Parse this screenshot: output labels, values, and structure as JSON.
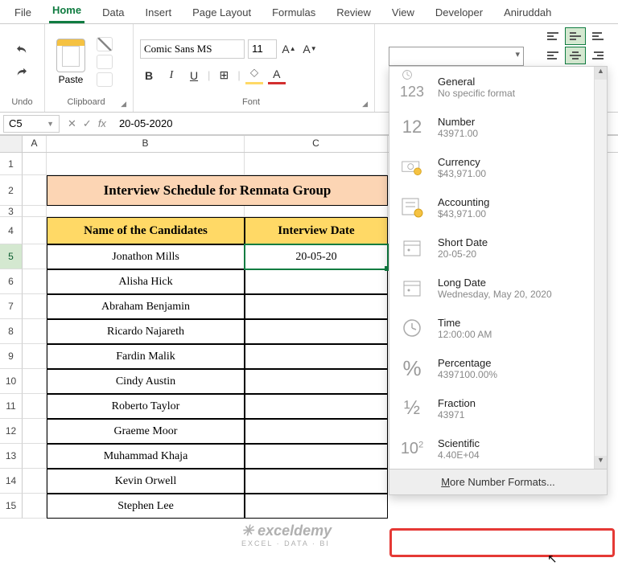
{
  "tabs": [
    "File",
    "Home",
    "Data",
    "Insert",
    "Page Layout",
    "Formulas",
    "Review",
    "View",
    "Developer",
    "Aniruddah"
  ],
  "ribbon": {
    "undo": "Undo",
    "clipboard": "Clipboard",
    "paste": "Paste",
    "font": "Font",
    "fontName": "Comic Sans MS",
    "fontSize": "11"
  },
  "namebox": "C5",
  "fx": "fx",
  "formula": "20-05-2020",
  "cols": [
    "A",
    "B",
    "C"
  ],
  "title": "Interview Schedule for Rennata Group",
  "headers": {
    "name": "Name of the Candidates",
    "date": "Interview Date"
  },
  "rows": [
    {
      "n": "Jonathon Mills",
      "d": "20-05-20"
    },
    {
      "n": "Alisha Hick",
      "d": ""
    },
    {
      "n": "Abraham Benjamin",
      "d": ""
    },
    {
      "n": "Ricardo Najareth",
      "d": ""
    },
    {
      "n": "Fardin Malik",
      "d": ""
    },
    {
      "n": "Cindy Austin",
      "d": ""
    },
    {
      "n": "Roberto Taylor",
      "d": ""
    },
    {
      "n": "Graeme Moor",
      "d": ""
    },
    {
      "n": "Muhammad Khaja",
      "d": ""
    },
    {
      "n": "Kevin Orwell",
      "d": ""
    },
    {
      "n": "Stephen Lee",
      "d": ""
    }
  ],
  "formats": [
    {
      "icon": "123",
      "title": "General",
      "sub": "No specific format"
    },
    {
      "icon": "12",
      "title": "Number",
      "sub": "43971.00"
    },
    {
      "icon": "cur",
      "title": "Currency",
      "sub": "$43,971.00"
    },
    {
      "icon": "acc",
      "title": "Accounting",
      "sub": "$43,971.00"
    },
    {
      "icon": "cal",
      "title": "Short Date",
      "sub": "20-05-20"
    },
    {
      "icon": "cal",
      "title": "Long Date",
      "sub": "Wednesday, May 20, 2020"
    },
    {
      "icon": "clk",
      "title": "Time",
      "sub": "12:00:00 AM"
    },
    {
      "icon": "%",
      "title": "Percentage",
      "sub": "4397100.00%"
    },
    {
      "icon": "½",
      "title": "Fraction",
      "sub": "43971"
    },
    {
      "icon": "10²",
      "title": "Scientific",
      "sub": "4.40E+04"
    }
  ],
  "more": "More Number Formats...",
  "wm": {
    "t1": "exceldemy",
    "t2": "EXCEL · DATA · BI"
  }
}
